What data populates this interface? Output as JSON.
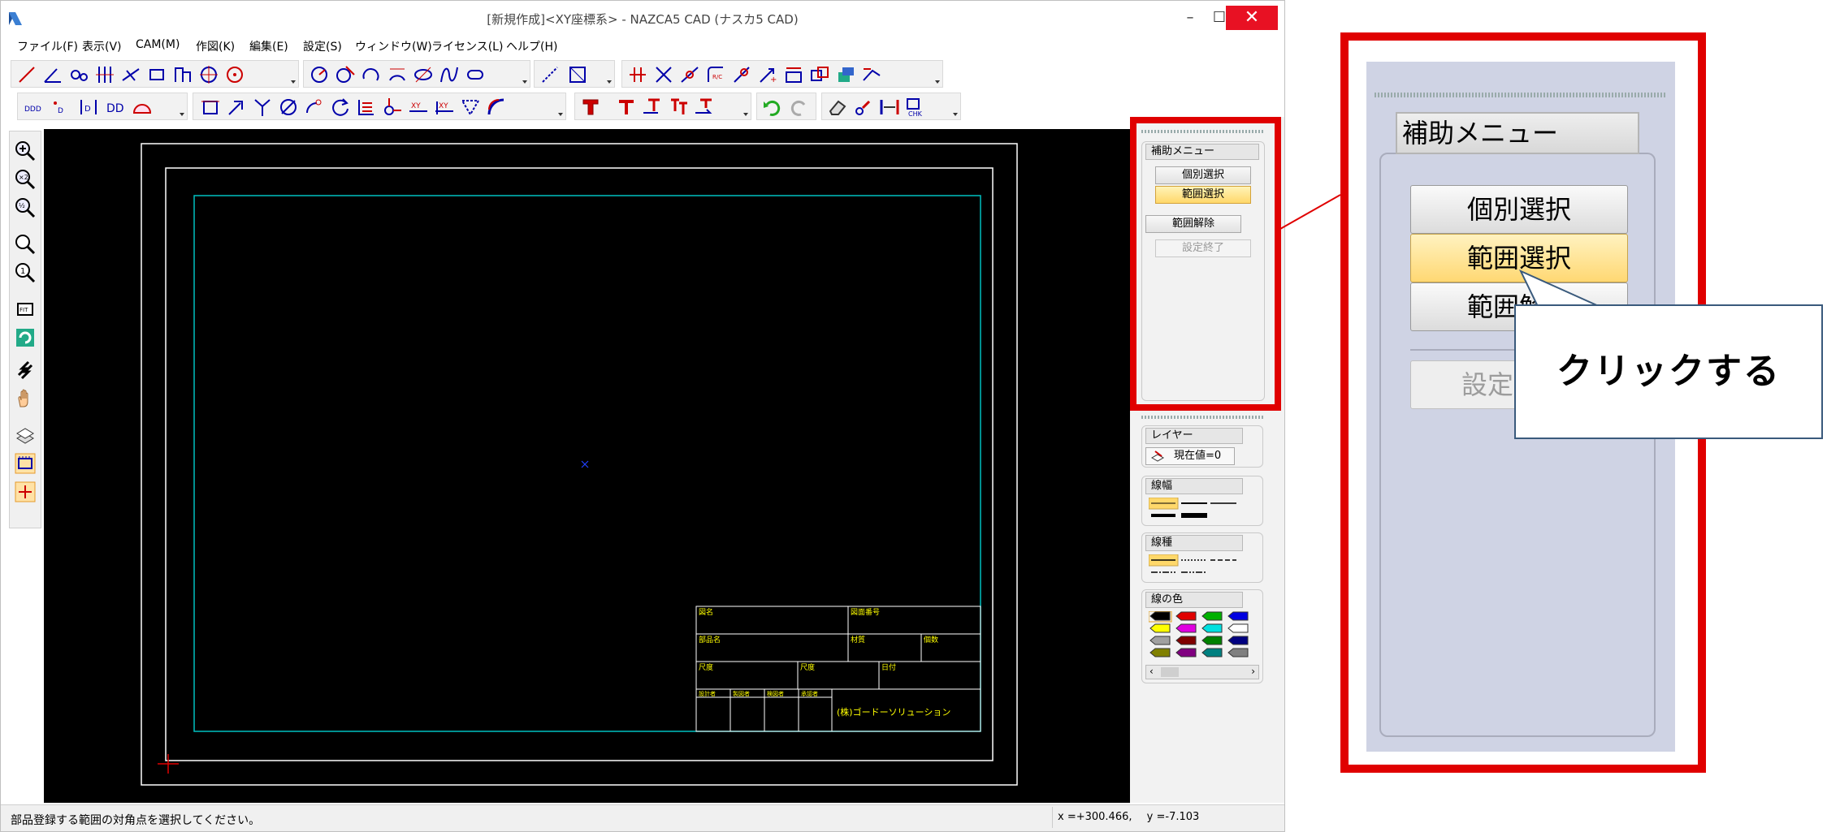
{
  "window": {
    "title": "[新規作成]<XY座標系> - NAZCA5 CAD (ナスカ5 CAD)",
    "minimize_glyph": "–",
    "maximize_glyph": "☐",
    "close_glyph": "✕"
  },
  "menubar": [
    "ファイル(F)",
    "表示(V)",
    "CAM(M)",
    "作図(K)",
    "編集(E)",
    "設定(S)",
    "ウィンドウ(W)",
    "ライセンス(L)",
    "ヘルプ(H)"
  ],
  "aux_menu": {
    "header": "補助メニュー",
    "individual_select": "個別選択",
    "range_select": "範囲選択",
    "range_release": "範囲解除",
    "settings_end": "設定終了"
  },
  "panels": {
    "layer_header": "レイヤー",
    "layer_value": "現在値=0",
    "line_width_header": "線幅",
    "line_type_header": "線種",
    "line_color_header": "線の色",
    "line_colors": [
      "#000000",
      "#e00000",
      "#00b000",
      "#0000e0",
      "#ffff00",
      "#e000e0",
      "#00e0e0",
      "#ffffff",
      "#a0a0a0",
      "#800000",
      "#008000",
      "#000080",
      "#808000",
      "#800080",
      "#008080",
      "#808080"
    ]
  },
  "title_block": {
    "drawing_name": "図名",
    "drawing_number": "図面番号",
    "part_name": "部品名",
    "material": "材質",
    "count": "個数",
    "scale": "尺度",
    "dimension": "尺度",
    "date": "日付",
    "designer": "設計者",
    "drafter": "製図者",
    "checker": "検図者",
    "approver": "承認者",
    "company": "(株)ゴードーソリューション"
  },
  "statusbar": {
    "message": "部品登録する範囲の対角点を選択してください。",
    "x_coord": "x =+300.466,",
    "y_coord": "y =-7.103"
  },
  "zoom_callout": {
    "text": "クリックする"
  },
  "colors": {
    "highlight_red": "#e00000",
    "selected_yellow": "#ffd86a",
    "canvas_black": "#000000",
    "frame_cyan": "#00c0c0",
    "title_block_yellow": "#ffff00"
  },
  "icons": {
    "left_tools": [
      "zoom-in-icon",
      "zoom-x2-icon",
      "zoom-half-icon",
      "zoom-window-icon",
      "zoom-actual-icon",
      "fit-icon",
      "redraw-icon",
      "pan-arrows-icon",
      "hand-pan-icon",
      "layer-icon",
      "grid-icon",
      "crosshair-icon"
    ]
  }
}
